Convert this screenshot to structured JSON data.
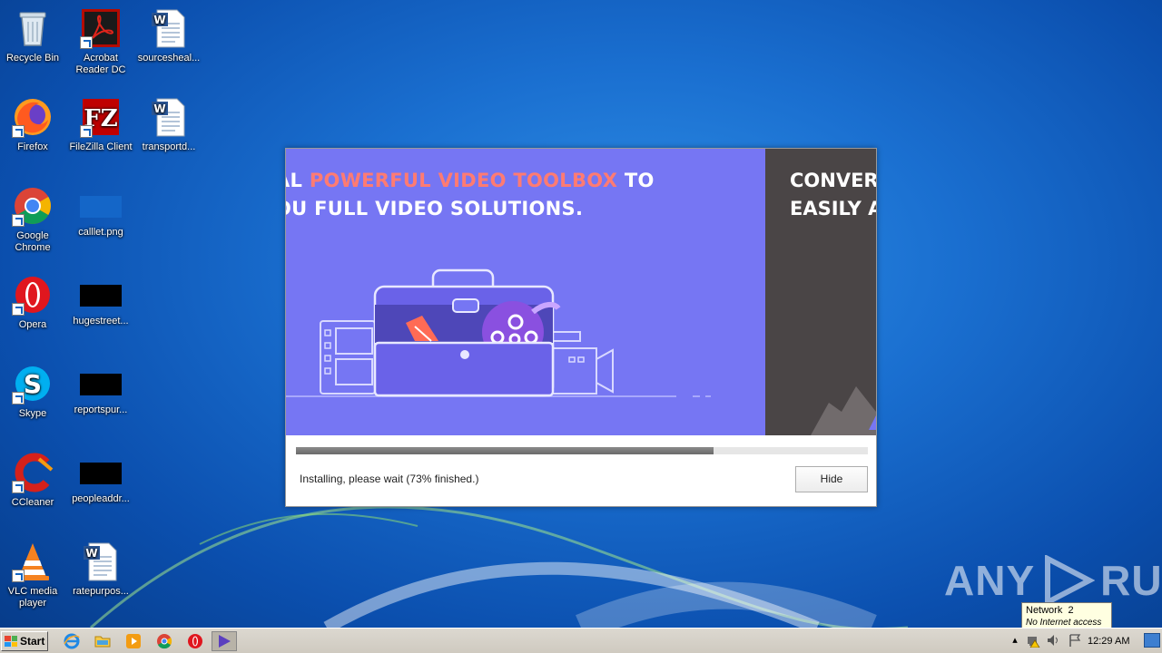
{
  "desktop": {
    "icons": [
      {
        "label": "Recycle Bin"
      },
      {
        "label": "Acrobat Reader DC"
      },
      {
        "label": "sourcesheal..."
      },
      {
        "label": "Firefox"
      },
      {
        "label": "FileZilla Client"
      },
      {
        "label": "transportd..."
      },
      {
        "label": "Google Chrome"
      },
      {
        "label": "calllet.png"
      },
      {
        "label": "Opera"
      },
      {
        "label": "hugestreet..."
      },
      {
        "label": "Skype"
      },
      {
        "label": "reportspur..."
      },
      {
        "label": "CCleaner"
      },
      {
        "label": "peopleaddr..."
      },
      {
        "label": "VLC media player"
      },
      {
        "label": "ratepurpos..."
      }
    ]
  },
  "installer": {
    "banner": {
      "line1_prefix": "AL ",
      "line1_highlight": "POWERFUL VIDEO TOOLBOX",
      "line1_suffix": " TO",
      "line2": "OU FULL VIDEO SOLUTIONS.",
      "right_line1": "CONVERT",
      "right_line2": "EASILY AI"
    },
    "progress_fraction": 0.73,
    "status": "Installing, please wait (73% finished.)",
    "hide_label": "Hide"
  },
  "watermark": {
    "text_left": "ANY",
    "text_right": "RUN"
  },
  "tooltip": {
    "title": "Network  2",
    "subtitle": "No Internet access"
  },
  "taskbar": {
    "start_label": "Start",
    "clock": "12:29 AM"
  },
  "colors": {
    "banner_bg": "#7676f3",
    "banner_dark": "#4a4546",
    "highlight": "#ff7b72"
  }
}
